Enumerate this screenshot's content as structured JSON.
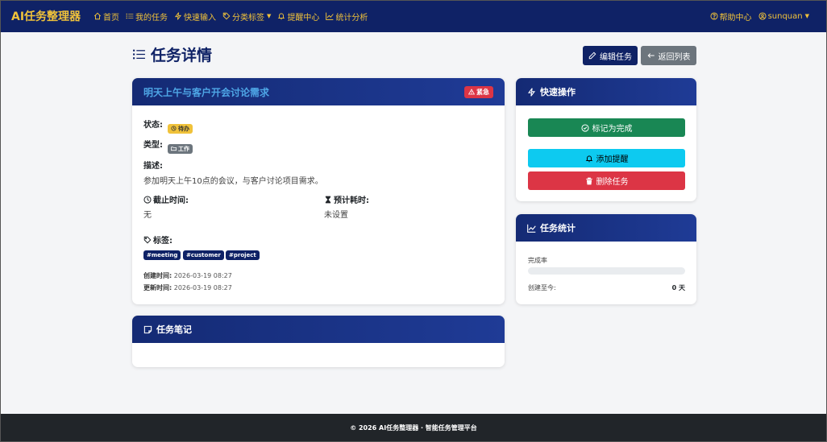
{
  "nav": {
    "brand": "AI任务整理器",
    "items": [
      {
        "label": "首页",
        "icon": "home-icon"
      },
      {
        "label": "我的任务",
        "icon": "list-icon"
      },
      {
        "label": "快速输入",
        "icon": "lightning-icon"
      },
      {
        "label": "分类标签",
        "icon": "tag-icon"
      },
      {
        "label": "提醒中心",
        "icon": "bell-icon"
      },
      {
        "label": "统计分析",
        "icon": "chart-icon"
      }
    ],
    "help": "帮助中心",
    "user": "sunquan"
  },
  "page": {
    "title": "任务详情",
    "edit_button": "编辑任务",
    "back_button": "返回列表"
  },
  "task": {
    "title": "明天上午与客户开会讨论需求",
    "priority_badge": "紧急",
    "status_label": "状态:",
    "status_value": "待办",
    "type_label": "类型:",
    "type_value": "工作",
    "desc_label": "描述:",
    "desc_value": "参加明天上午10点的会议，与客户讨论项目需求。",
    "deadline_label": "截止时间:",
    "deadline_value": "无",
    "estimate_label": "预计耗时:",
    "estimate_value": "未设置",
    "tags_label": "标签:",
    "tags": [
      "#meeting",
      "#customer",
      "#project"
    ],
    "created_label": "创建时间:",
    "created_value": "2026-03-19 08:27",
    "updated_label": "更新时间:",
    "updated_value": "2026-03-19 08:27"
  },
  "notes": {
    "title": "任务笔记"
  },
  "quick": {
    "title": "快速操作",
    "mark_done": "标记为完成",
    "add_reminder": "添加提醒",
    "delete": "删除任务"
  },
  "stats": {
    "title": "任务统计",
    "completion_label": "完成率",
    "completion_percent": 0,
    "created_since_label": "创建至今:",
    "created_since_value": "0 天"
  },
  "footer": {
    "text": "© 2026 AI任务整理器 · 智能任务管理平台"
  },
  "colors": {
    "nav_bg": "#0f2266",
    "nav_text": "#f0c23a",
    "urgent": "#dc3545",
    "success": "#198754",
    "info": "#0dcaf0",
    "secondary": "#6c757d",
    "footer_bg": "#212529"
  }
}
